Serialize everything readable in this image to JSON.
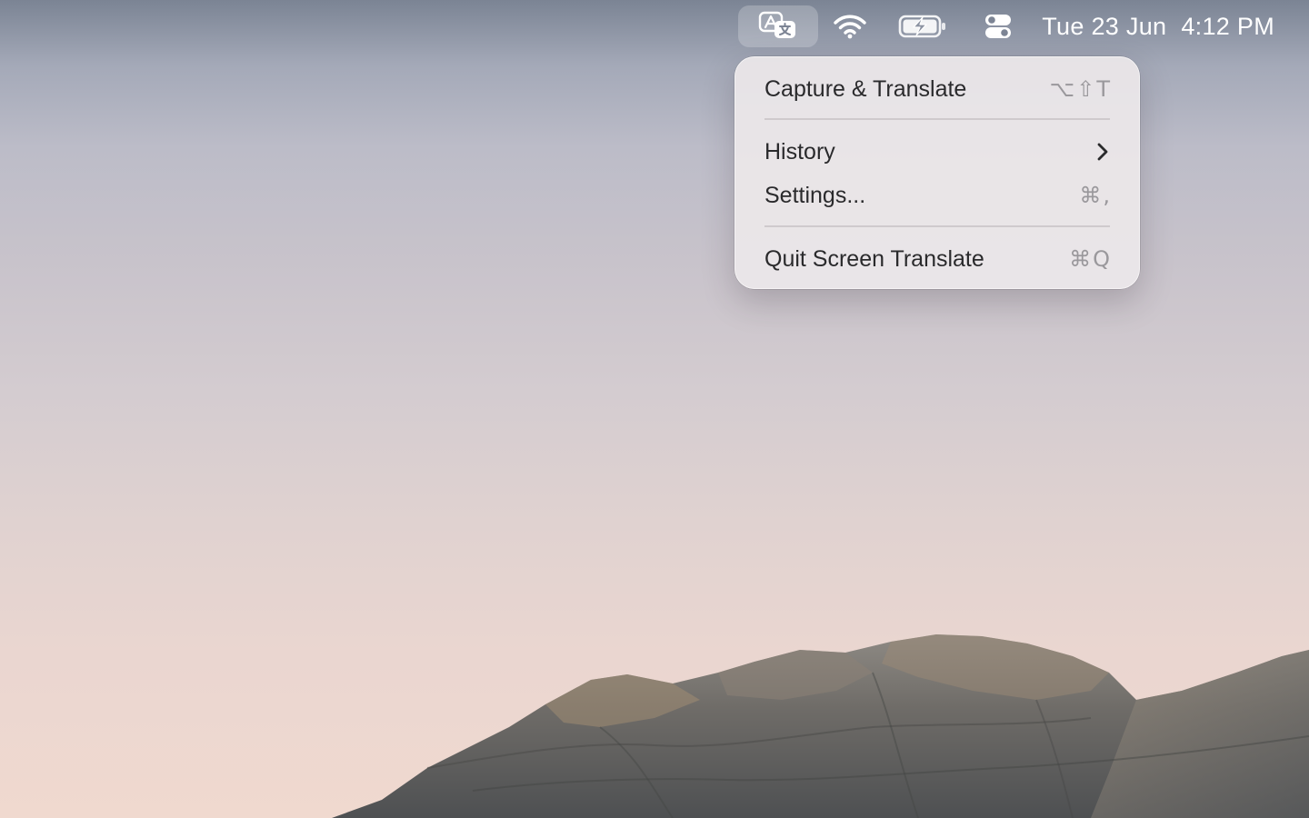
{
  "menubar": {
    "status_icons": [
      "translate-icon",
      "wifi-icon",
      "battery-charging-icon",
      "control-center-icon"
    ],
    "clock": {
      "date": "Tue 23 Jun",
      "time": "4:12 PM"
    }
  },
  "menu": {
    "items": [
      {
        "label": "Capture & Translate",
        "shortcut": "⌥⇧T"
      },
      {
        "label": "History",
        "submenu_icon": "chevron-right-icon"
      },
      {
        "label": "Settings...",
        "shortcut": "⌘,"
      },
      {
        "label": "Quit Screen Translate",
        "shortcut": "⌘Q"
      }
    ]
  },
  "colors": {
    "menu_text": "#2a2a2c",
    "shortcut_text": "#9a989c",
    "menubar_text": "#ffffff"
  }
}
